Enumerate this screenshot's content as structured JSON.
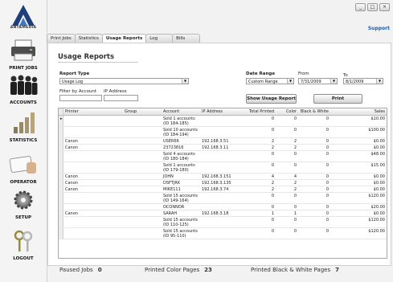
{
  "app": {
    "logo_text": "ANTAMEDIA",
    "support": "Support"
  },
  "window_buttons": {
    "minimize": "_",
    "maximize": "□",
    "close": "×"
  },
  "sidebar": [
    {
      "label": "PRINT JOBS",
      "icon": "printer-icon"
    },
    {
      "label": "ACCOUNTS",
      "icon": "people-icon"
    },
    {
      "label": "STATISTICS",
      "icon": "bar-chart-icon"
    },
    {
      "label": "OPERATOR",
      "icon": "id-card-icon"
    },
    {
      "label": "SETUP",
      "icon": "gear-icon"
    },
    {
      "label": "LOGOUT",
      "icon": "keys-icon"
    }
  ],
  "tabs": [
    "Print Jobs",
    "Statistics",
    "Usage Reports",
    "Log",
    "Bills"
  ],
  "active_tab": "Usage Reports",
  "page_title": "Usage Reports",
  "report_type": {
    "label": "Report Type",
    "value": "Usage Log"
  },
  "filters": {
    "account_label": "Filter by Account",
    "ip_label": "IP Address",
    "account_value": "",
    "ip_value": ""
  },
  "date_range": {
    "label": "Date Range",
    "value": "Custom Range",
    "from_label": "From",
    "from_value": "7/31/2009",
    "to_label": "To",
    "to_value": "8/1/2009"
  },
  "buttons": {
    "show_report": "Show Usage Report",
    "print": "Print"
  },
  "table": {
    "columns": [
      "Printer",
      "Group",
      "Account",
      "IP Address",
      "Total Printed",
      "Color",
      "Black & White",
      "Sales"
    ],
    "rows": [
      [
        "",
        "",
        "Sold 1 accounts (ID 184-185)",
        "",
        "0",
        "0",
        "0",
        "$10.00"
      ],
      [
        "",
        "",
        "Sold 10 accounts (ID 184-194)",
        "",
        "0",
        "0",
        "0",
        "$100.00"
      ],
      [
        "Canon",
        "",
        "USER66",
        "192.168.3.51",
        "2",
        "2",
        "0",
        "$0.00"
      ],
      [
        "Canon",
        "",
        "23723816",
        "192.168.3.11",
        "2",
        "2",
        "0",
        "$0.00"
      ],
      [
        "",
        "",
        "Sold 4 accounts (ID 180-184)",
        "",
        "0",
        "0",
        "0",
        "$48.00"
      ],
      [
        "",
        "",
        "Sold 1 accounts (ID 179-180)",
        "",
        "0",
        "0",
        "0",
        "$15.00"
      ],
      [
        "Canon",
        "",
        "JOHN",
        "192.168.3.151",
        "4",
        "4",
        "0",
        "$0.00"
      ],
      [
        "Canon",
        "",
        "DSFTJRK",
        "192.168.3.135",
        "2",
        "2",
        "0",
        "$0.00"
      ],
      [
        "Canon",
        "",
        "MIKE111",
        "192.168.3.74",
        "2",
        "2",
        "0",
        "$0.00"
      ],
      [
        "",
        "",
        "Sold 15 accounts (ID 149-164)",
        "",
        "0",
        "0",
        "0",
        "$120.00"
      ],
      [
        "",
        "",
        "OCONNOR",
        "",
        "0",
        "0",
        "0",
        "$20.00"
      ],
      [
        "Canon",
        "",
        "SARAH",
        "192.168.3.18",
        "1",
        "1",
        "0",
        "$0.00"
      ],
      [
        "",
        "",
        "Sold 15 accounts (ID 110-125)",
        "",
        "0",
        "0",
        "0",
        "$120.00"
      ],
      [
        "",
        "",
        "Sold 15 accounts (ID 95-110)",
        "",
        "0",
        "0",
        "0",
        "$120.00"
      ]
    ]
  },
  "stats": {
    "paused_label": "Paused Jobs",
    "paused_value": "0",
    "color_label": "Printed Color Pages",
    "color_value": "23",
    "bw_label": "Printed Black & White Pages",
    "bw_value": "7"
  }
}
